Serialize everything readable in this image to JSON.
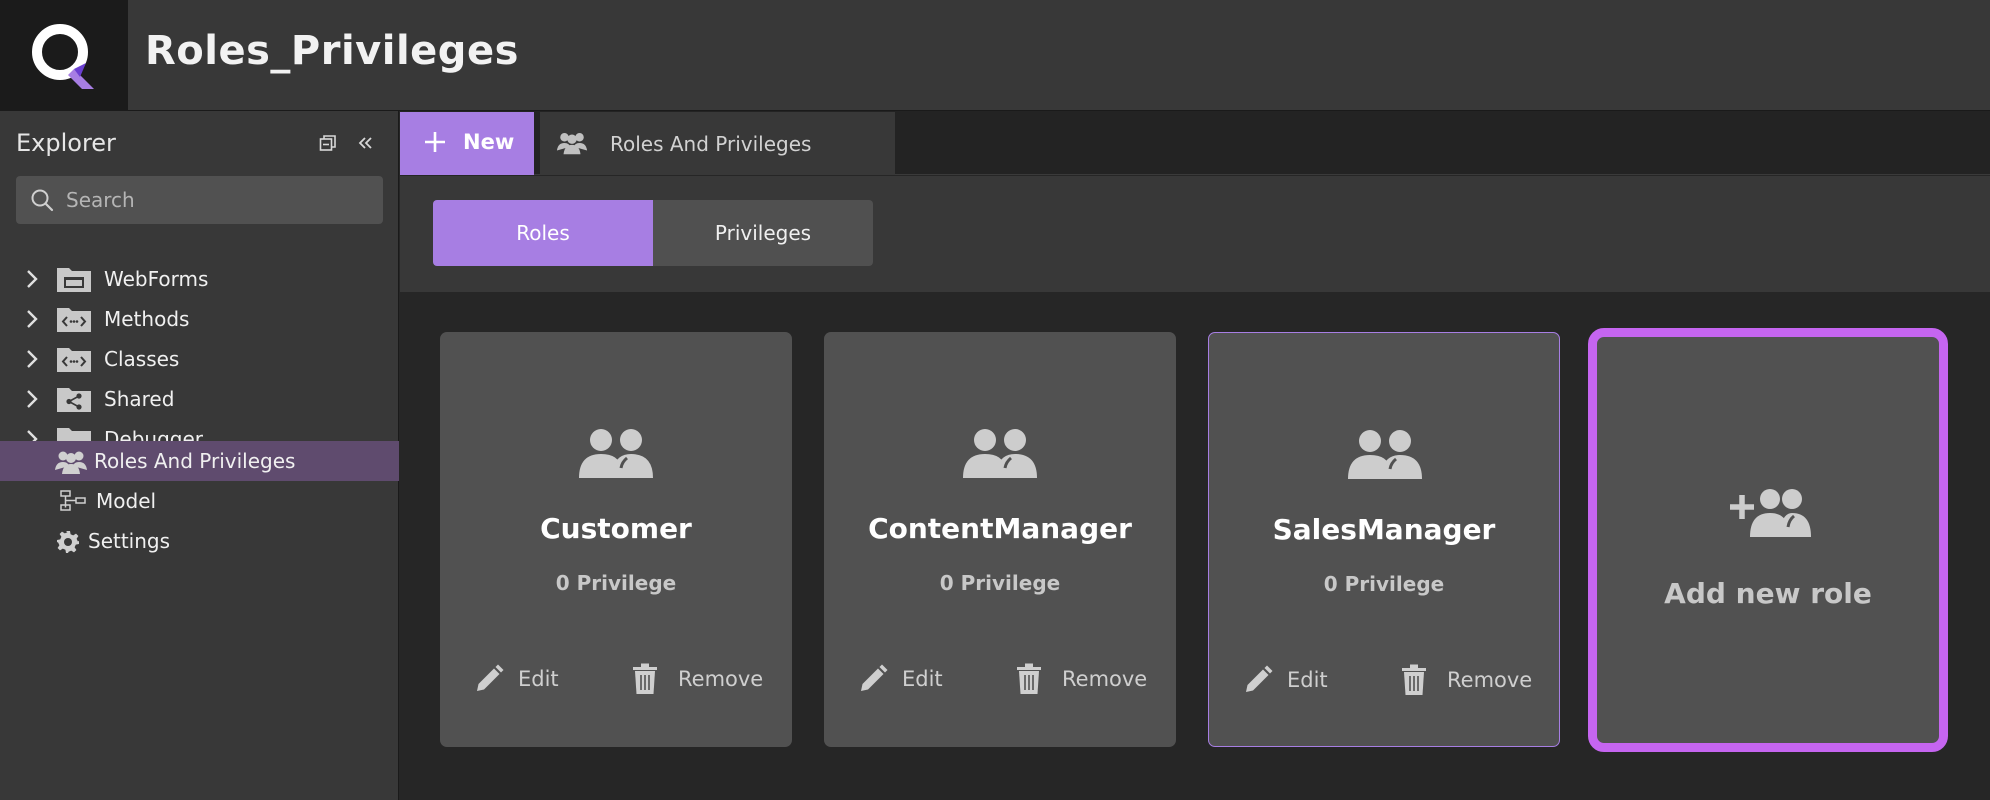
{
  "app": {
    "title": "Roles_Privileges"
  },
  "sidebar": {
    "title": "Explorer",
    "search_placeholder": "Search",
    "items": [
      {
        "label": "WebForms",
        "icon": "webforms-folder-icon",
        "expandable": true
      },
      {
        "label": "Methods",
        "icon": "methods-folder-icon",
        "expandable": true
      },
      {
        "label": "Classes",
        "icon": "classes-folder-icon",
        "expandable": true
      },
      {
        "label": "Shared",
        "icon": "shared-folder-icon",
        "expandable": true
      },
      {
        "label": "Debugger",
        "icon": "folder-icon",
        "expandable": true
      },
      {
        "label": "Roles And Privileges",
        "icon": "roles-icon",
        "selected": true
      },
      {
        "label": "Model",
        "icon": "model-icon"
      },
      {
        "label": "Settings",
        "icon": "gear-icon"
      }
    ]
  },
  "tabs": {
    "new_label": "New",
    "active_tab": "Roles And Privileges"
  },
  "toggle": {
    "roles_label": "Roles",
    "privileges_label": "Privileges",
    "selected": "Roles"
  },
  "roles": [
    {
      "name": "Customer",
      "privileges": "0 Privilege",
      "edit_label": "Edit",
      "remove_label": "Remove"
    },
    {
      "name": "ContentManager",
      "privileges": "0 Privilege",
      "edit_label": "Edit",
      "remove_label": "Remove"
    },
    {
      "name": "SalesManager",
      "privileges": "0 Privilege",
      "edit_label": "Edit",
      "remove_label": "Remove"
    }
  ],
  "add_role": {
    "label": "Add new role"
  },
  "colors": {
    "accent": "#a77ee3",
    "add_card_border": "#c565f0",
    "selected_item": "#5f4b6e",
    "card_bg": "#515151"
  }
}
